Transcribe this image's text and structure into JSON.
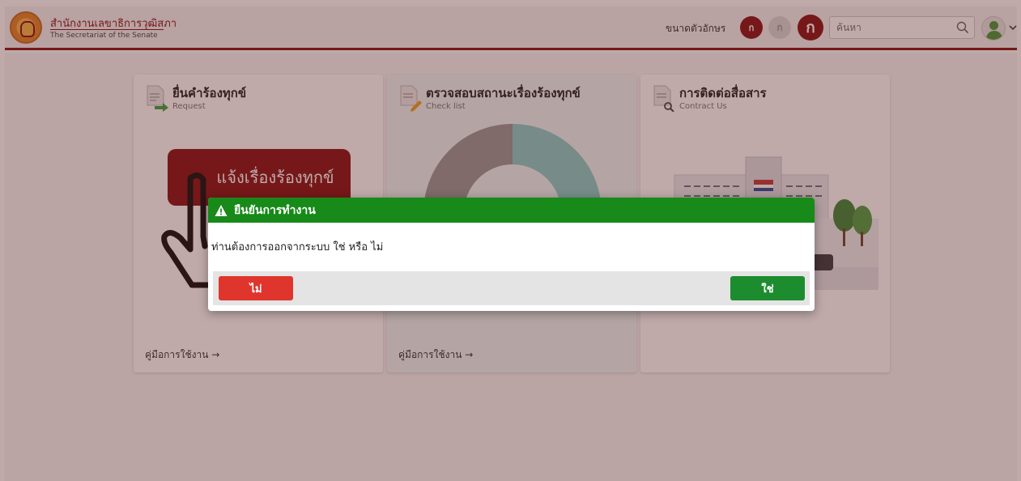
{
  "header": {
    "org_name_th": "สำนักงานเลขาธิการวุฒิสภา",
    "org_name_en": "The Secretariat of the Senate",
    "font_size_label": "ขนาดตัวอักษร",
    "font_size_options": [
      "ก",
      "ก",
      "ก"
    ],
    "search_placeholder": "ค้นหา"
  },
  "cards": [
    {
      "title": "ยื่นคำร้องทุกข์",
      "subtitle": "Request",
      "button_label": "แจ้งเรื่องร้องทุกข์",
      "manual_link": "คู่มือการใช้งาน →",
      "icon": "document-arrow-icon"
    },
    {
      "title": "ตรวจสอบสถานะเรื่องร้องทุกข์",
      "subtitle": "Check list",
      "manual_link": "คู่มือการใช้งาน →",
      "icon": "document-pencil-icon"
    },
    {
      "title": "การติดต่อสื่อสาร",
      "subtitle": "Contract Us",
      "icon": "document-search-icon"
    }
  ],
  "modal": {
    "title": "ยืนยันการทำงาน",
    "message": "ท่านต้องการออกจากระบบ ใช่ หรือ ไม่",
    "cancel_label": "ไม่",
    "confirm_label": "ใช่"
  },
  "colors": {
    "brand": "#8a1518",
    "modal_header": "#178a19",
    "cancel": "#e0352c",
    "confirm": "#1c8c2e",
    "chart_gray": "#9a9a9a",
    "chart_teal": "#8ccfcb"
  }
}
